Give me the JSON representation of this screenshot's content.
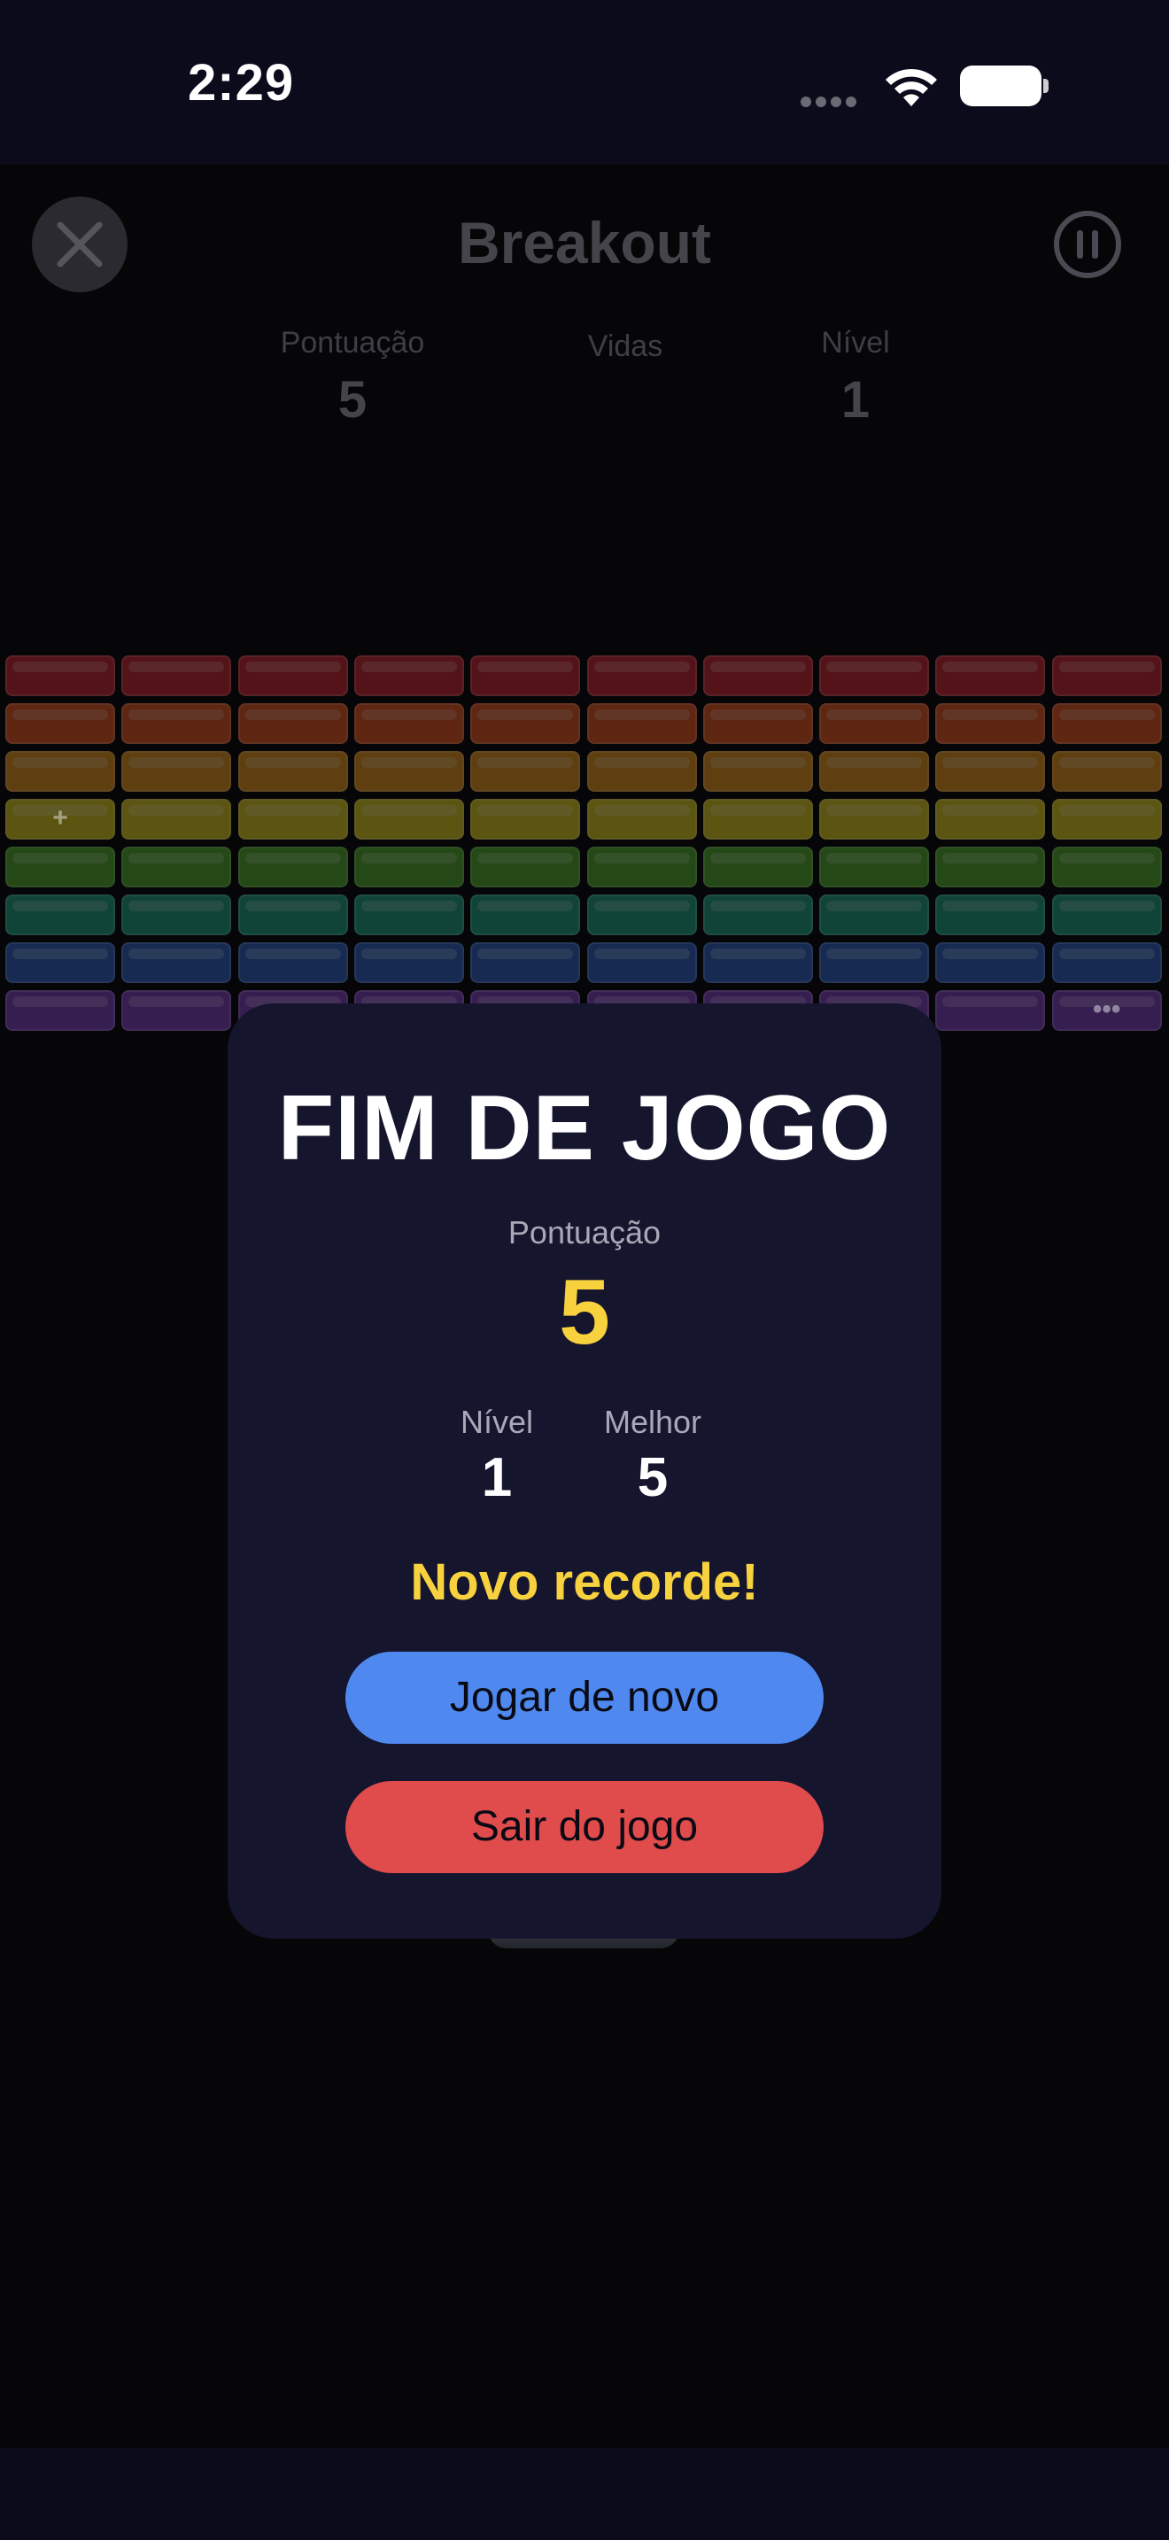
{
  "status": {
    "time": "2:29"
  },
  "header": {
    "title": "Breakout",
    "close_icon": "close-icon",
    "pause_icon": "pause-icon"
  },
  "hud": {
    "score_label": "Pontuação",
    "score_value": "5",
    "lives_label": "Vidas",
    "level_label": "Nível",
    "level_value": "1"
  },
  "bricks": {
    "columns": 10,
    "rows": [
      {
        "color": "#c0272d"
      },
      {
        "color": "#d9531e"
      },
      {
        "color": "#d98e1a"
      },
      {
        "color": "#d4c21e"
      },
      {
        "color": "#4ea628"
      },
      {
        "color": "#1f9a7a"
      },
      {
        "color": "#2f5fb8"
      },
      {
        "color": "#7a3fb5"
      }
    ],
    "special_marks": [
      {
        "row": 3,
        "col": 0,
        "symbol": "+"
      },
      {
        "row": 7,
        "col": 9,
        "symbol": "•••"
      }
    ]
  },
  "modal": {
    "title": "FIM DE JOGO",
    "score_label": "Pontuação",
    "score_value": "5",
    "level_label": "Nível",
    "level_value": "1",
    "best_label": "Melhor",
    "best_value": "5",
    "record_text": "Novo recorde!",
    "play_again_label": "Jogar de novo",
    "exit_label": "Sair do jogo",
    "accent_color": "#f7d23e",
    "play_color": "#4f89f0",
    "exit_color": "#e04b4b"
  }
}
